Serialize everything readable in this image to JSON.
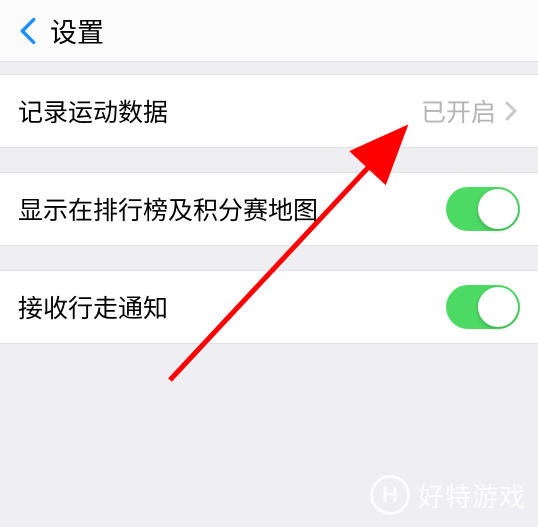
{
  "header": {
    "title": "设置"
  },
  "rows": {
    "record": {
      "label": "记录运动数据",
      "status": "已开启"
    },
    "ranking": {
      "label": "显示在排行榜及积分赛地图"
    },
    "notify": {
      "label": "接收行走通知"
    }
  },
  "watermark": {
    "badge": "H",
    "text": "好特游戏"
  }
}
